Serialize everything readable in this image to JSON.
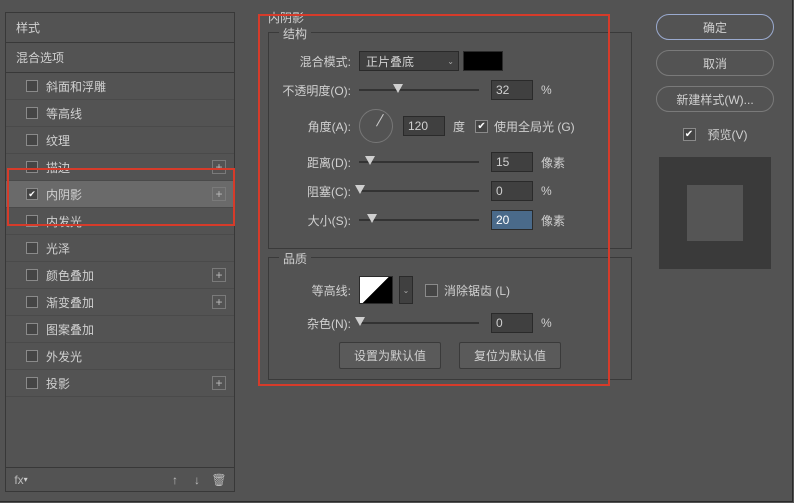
{
  "sidebar": {
    "header": "样式",
    "subheader": "混合选项",
    "items": [
      {
        "label": "斜面和浮雕",
        "checked": false,
        "plus": false
      },
      {
        "label": "等高线",
        "checked": false,
        "plus": false
      },
      {
        "label": "纹理",
        "checked": false,
        "plus": false
      },
      {
        "label": "描边",
        "checked": false,
        "plus": true
      },
      {
        "label": "内阴影",
        "checked": true,
        "plus": true,
        "selected": true
      },
      {
        "label": "内发光",
        "checked": false,
        "plus": false
      },
      {
        "label": "光泽",
        "checked": false,
        "plus": false
      },
      {
        "label": "颜色叠加",
        "checked": false,
        "plus": true
      },
      {
        "label": "渐变叠加",
        "checked": false,
        "plus": true
      },
      {
        "label": "图案叠加",
        "checked": false,
        "plus": false
      },
      {
        "label": "外发光",
        "checked": false,
        "plus": false
      },
      {
        "label": "投影",
        "checked": false,
        "plus": true
      }
    ]
  },
  "main": {
    "title": "内阴影",
    "structure": {
      "legend": "结构",
      "blend_label": "混合模式:",
      "blend_value": "正片叠底",
      "opacity_label": "不透明度(O):",
      "opacity_value": "32",
      "opacity_unit": "%",
      "angle_label": "角度(A):",
      "angle_value": "120",
      "angle_unit": "度",
      "global_light": "使用全局光 (G)",
      "distance_label": "距离(D):",
      "distance_value": "15",
      "distance_unit": "像素",
      "choke_label": "阻塞(C):",
      "choke_value": "0",
      "choke_unit": "%",
      "size_label": "大小(S):",
      "size_value": "20",
      "size_unit": "像素"
    },
    "quality": {
      "legend": "品质",
      "contour_label": "等高线:",
      "antialias": "消除锯齿 (L)",
      "noise_label": "杂色(N):",
      "noise_value": "0",
      "noise_unit": "%"
    },
    "buttons": {
      "default": "设置为默认值",
      "reset": "复位为默认值"
    }
  },
  "right": {
    "ok": "确定",
    "cancel": "取消",
    "newstyle": "新建样式(W)...",
    "preview_label": "预览(V)"
  }
}
